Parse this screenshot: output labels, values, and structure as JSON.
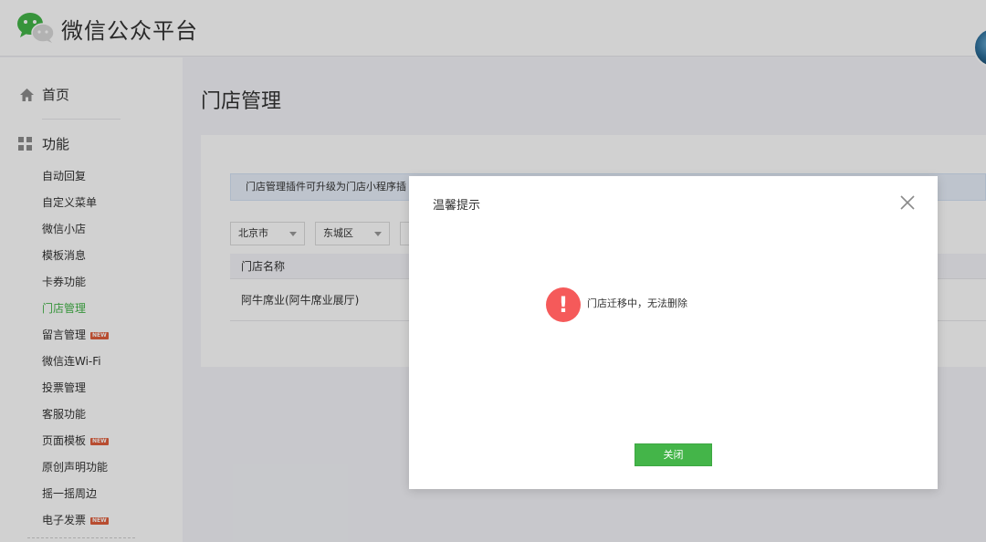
{
  "header": {
    "brand": "微信公众平台"
  },
  "sidebar": {
    "home_label": "首页",
    "group_label": "功能",
    "items": [
      {
        "label": "自动回复",
        "active": false,
        "new": false
      },
      {
        "label": "自定义菜单",
        "active": false,
        "new": false
      },
      {
        "label": "微信小店",
        "active": false,
        "new": false
      },
      {
        "label": "模板消息",
        "active": false,
        "new": false
      },
      {
        "label": "卡券功能",
        "active": false,
        "new": false
      },
      {
        "label": "门店管理",
        "active": true,
        "new": false
      },
      {
        "label": "留言管理",
        "active": false,
        "new": true
      },
      {
        "label": "微信连Wi-Fi",
        "active": false,
        "new": false
      },
      {
        "label": "投票管理",
        "active": false,
        "new": false
      },
      {
        "label": "客服功能",
        "active": false,
        "new": false
      },
      {
        "label": "页面模板",
        "active": false,
        "new": true
      },
      {
        "label": "原创声明功能",
        "active": false,
        "new": false
      },
      {
        "label": "摇一摇周边",
        "active": false,
        "new": false
      },
      {
        "label": "电子发票",
        "active": false,
        "new": true
      }
    ],
    "new_badge": "NEW"
  },
  "main": {
    "title": "门店管理",
    "tip": "门店管理插件可升级为门店小程序插",
    "city_select": "北京市",
    "district_select": "东城区",
    "table_header": "门店名称",
    "row_name": "阿牛席业(阿牛席业展厅)"
  },
  "dialog": {
    "title": "温馨提示",
    "alert_symbol": "!",
    "message": "门店迁移中，无法删除",
    "close_button": "关闭"
  },
  "colors": {
    "accent_green": "#44b549",
    "alert_red": "#f55a5a",
    "new_badge": "#e15f3c"
  }
}
